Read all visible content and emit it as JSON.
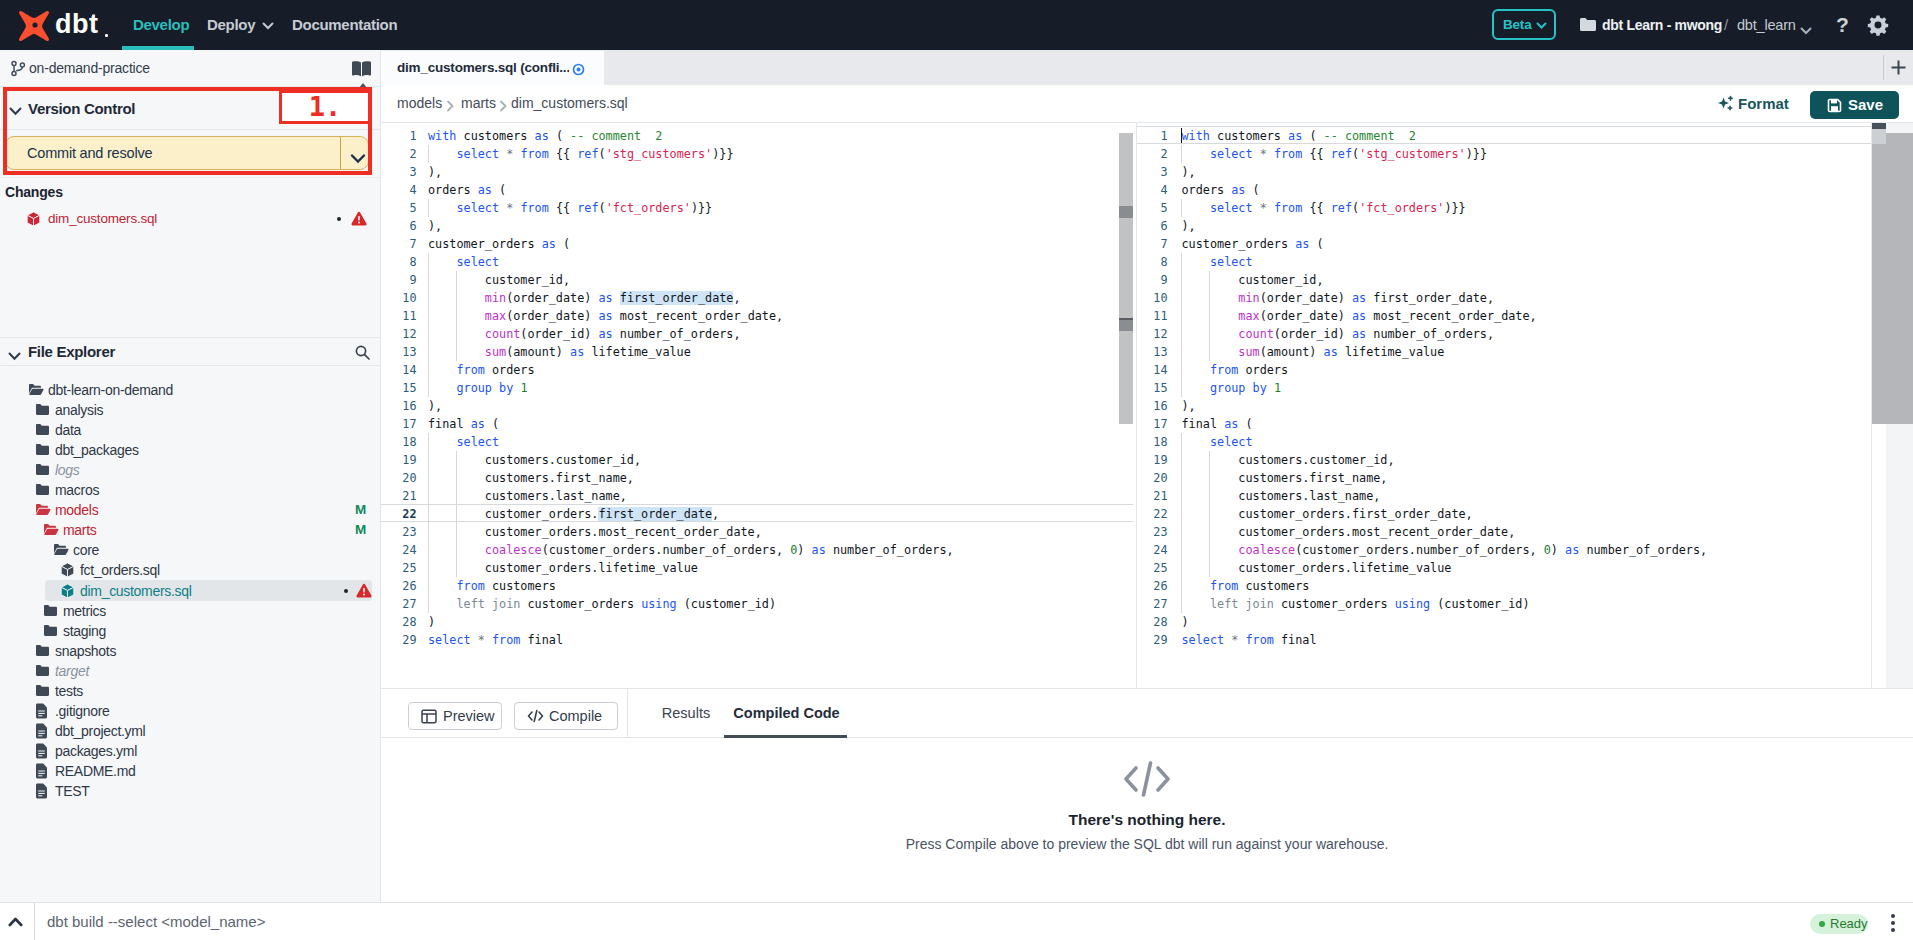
{
  "navbar": {
    "logo_text": "dbt",
    "items": [
      {
        "label": "Develop",
        "active": true
      },
      {
        "label": "Deploy",
        "has_chevron": true
      },
      {
        "label": "Documentation"
      }
    ],
    "beta_label": "Beta",
    "account_name": "dbt Learn - mwong",
    "separator": "/",
    "project_name": "dbt_learn",
    "help_label": "?"
  },
  "sidebar": {
    "branch_name": "on-demand-practice",
    "annotation_label": "1.",
    "version_control": {
      "title": "Version Control",
      "commit_button_label": "Commit and resolve",
      "changes_label": "Changes",
      "changes": [
        {
          "file": "dim_customers.sql",
          "icon": "model",
          "status": "conflict"
        }
      ]
    },
    "file_explorer": {
      "title": "File Explorer",
      "items": [
        {
          "label": "dbt-learn-on-demand",
          "level": 0,
          "icon": "folder-open",
          "style": "normal"
        },
        {
          "label": "analysis",
          "level": 1,
          "icon": "folder",
          "style": "normal"
        },
        {
          "label": "data",
          "level": 1,
          "icon": "folder",
          "style": "normal"
        },
        {
          "label": "dbt_packages",
          "level": 1,
          "icon": "folder",
          "style": "normal"
        },
        {
          "label": "logs",
          "level": 1,
          "icon": "folder",
          "style": "muted"
        },
        {
          "label": "macros",
          "level": 1,
          "icon": "folder",
          "style": "normal"
        },
        {
          "label": "models",
          "level": 1,
          "icon": "folder-open",
          "style": "red",
          "badge": "M"
        },
        {
          "label": "marts",
          "level": 2,
          "icon": "folder-open",
          "style": "red",
          "badge": "M"
        },
        {
          "label": "core",
          "level": 3,
          "icon": "folder-open",
          "style": "normal"
        },
        {
          "label": "fct_orders.sql",
          "level": 4,
          "icon": "model",
          "style": "normal"
        },
        {
          "label": "dim_customers.sql",
          "level": 4,
          "icon": "model",
          "style": "selected",
          "markers": [
            "dot",
            "warning"
          ]
        },
        {
          "label": "metrics",
          "level": 2,
          "icon": "folder",
          "style": "normal"
        },
        {
          "label": "staging",
          "level": 2,
          "icon": "folder",
          "style": "normal"
        },
        {
          "label": "snapshots",
          "level": 1,
          "icon": "folder",
          "style": "normal"
        },
        {
          "label": "target",
          "level": 1,
          "icon": "folder",
          "style": "muted"
        },
        {
          "label": "tests",
          "level": 1,
          "icon": "folder",
          "style": "normal"
        },
        {
          "label": ".gitignore",
          "level": 1,
          "icon": "file",
          "style": "normal"
        },
        {
          "label": "dbt_project.yml",
          "level": 1,
          "icon": "file",
          "style": "normal"
        },
        {
          "label": "packages.yml",
          "level": 1,
          "icon": "file",
          "style": "normal"
        },
        {
          "label": "README.md",
          "level": 1,
          "icon": "file",
          "style": "normal"
        },
        {
          "label": "TEST",
          "level": 1,
          "icon": "file",
          "style": "normal"
        }
      ]
    }
  },
  "editor": {
    "tab_label": "dim_customers.sql (confli...",
    "breadcrumbs": [
      "models",
      "marts",
      "dim_customers.sql"
    ],
    "format_label": "Format",
    "save_label": "Save",
    "code_lines": [
      "with customers as ( -- comment  2",
      "    select * from {{ ref('stg_customers')}}",
      "),",
      "orders as (",
      "    select * from {{ ref('fct_orders')}}",
      "),",
      "customer_orders as (",
      "    select",
      "        customer_id,",
      "        min(order_date) as first_order_date,",
      "        max(order_date) as most_recent_order_date,",
      "        count(order_id) as number_of_orders,",
      "        sum(amount) as lifetime_value",
      "    from orders",
      "    group by 1",
      "),",
      "final as (",
      "    select",
      "        customers.customer_id,",
      "        customers.first_name,",
      "        customers.last_name,",
      "        customer_orders.first_order_date,",
      "        customer_orders.most_recent_order_date,",
      "        coalesce(customer_orders.number_of_orders, 0) as number_of_orders,",
      "        customer_orders.lifetime_value",
      "    from customers",
      "    left join customer_orders using (customer_id)",
      ")",
      "select * from final"
    ],
    "left_pane": {
      "active_line": 22,
      "highlight_token": "first_order_date",
      "highlight_lines": [
        10,
        22
      ]
    },
    "right_pane": {
      "active_line": 1,
      "cursor_line": 1
    }
  },
  "bottom_panel": {
    "preview_label": "Preview",
    "compile_label": "Compile",
    "tabs": [
      {
        "label": "Results",
        "active": false
      },
      {
        "label": "Compiled Code",
        "active": true
      }
    ],
    "empty_state": {
      "title": "There's nothing here.",
      "subtitle": "Press Compile above to preview the SQL dbt will run against your warehouse."
    }
  },
  "status_bar": {
    "command_placeholder": "dbt build --select <model_name>",
    "ready_label": "Ready"
  },
  "colors": {
    "brand_orange": "#f94f2e",
    "accent_teal": "#2abdbd",
    "save_teal": "#0d5359",
    "annotation_red": "#ee2e23",
    "conflict_red": "#bf2433",
    "warning_red": "#d8282c",
    "modified_green": "#0f8a5a",
    "ready_green": "#35a745",
    "selected_teal": "#0c7e87",
    "keyword_blue": "#2254f0",
    "function_magenta": "#bb33c8",
    "string_red": "#d92351",
    "comment_green": "#27862f"
  }
}
